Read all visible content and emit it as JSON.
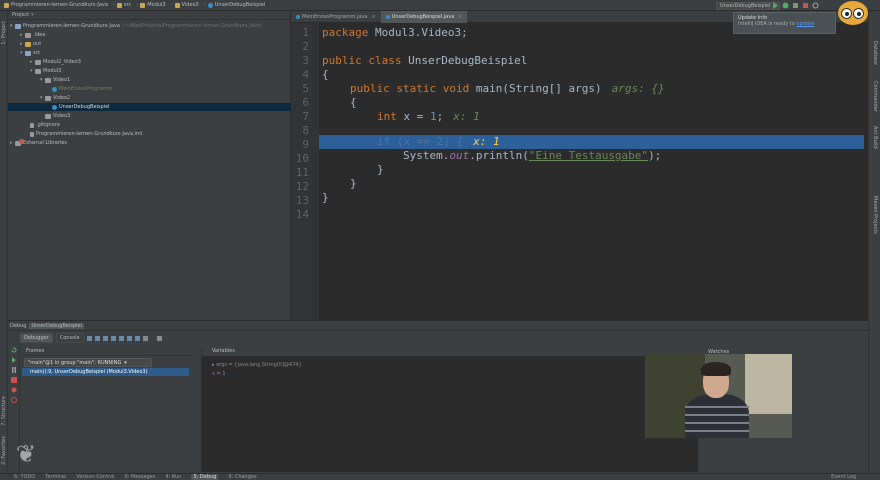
{
  "navbar": {
    "crumbs": [
      "Programmieren-lernen-Grundkurs-Java",
      "src",
      "Modul3",
      "Video3",
      "UnserDebugBeispiel"
    ],
    "run_config": "UnserDebugBeispiel"
  },
  "project": {
    "title": "Project",
    "tree": [
      {
        "label": "Programmieren-lernen-Grundkurs-Java",
        "path": "(~/WebProjects/Programmieren-lernen-Grundkurs-Java)"
      },
      {
        "label": ".idea"
      },
      {
        "label": "out"
      },
      {
        "label": "src"
      },
      {
        "label": "Modul2_Video3"
      },
      {
        "label": "Modul3"
      },
      {
        "label": "Video1"
      },
      {
        "label": "MeinErstesProgramm"
      },
      {
        "label": "Video2"
      },
      {
        "label": "UnserDebugBeispiel"
      },
      {
        "label": "Video3"
      },
      {
        "label": ".gitignore"
      },
      {
        "label": "Programmieren-lernen-Grundkurs-Java.iml"
      },
      {
        "label": "External Libraries"
      }
    ]
  },
  "tabs": [
    {
      "label": "MeinErstesProgramm.java"
    },
    {
      "label": "UnserDebugBeispiel.java"
    }
  ],
  "editor": {
    "line_numbers": [
      "1",
      "2",
      "3",
      "4",
      "5",
      "6",
      "7",
      "8",
      "9",
      "10",
      "11",
      "12",
      "13",
      "14"
    ],
    "l1_kw": "package",
    "l1_rest": " Modul3.Video3;",
    "l3_kw": "public class",
    "l3_rest": " UnserDebugBeispiel",
    "l4": "{",
    "l5_kw": "public static void",
    "l5_rest": " main(String[] args)",
    "l5_hint": "args: {}",
    "l6": "{",
    "l7_kw": "int",
    "l7_a": " x = ",
    "l7_num": "1",
    "l7_b": ";",
    "l7_hint": "x: 1",
    "l9_code": "if (x == 2) {",
    "l9_hint": "x: 1",
    "l10_a": "System.",
    "l10_out": "out",
    "l10_b": ".println(",
    "l10_str": "\"Eine Testausgabe\"",
    "l10_c": ");",
    "l11": "}",
    "l12": "}",
    "l13": "}"
  },
  "notification": {
    "title": "Update Info",
    "body": "IntelliJ IDEA is ready to ",
    "link": "update"
  },
  "debug": {
    "title": "Debug",
    "config": "UnserDebugBeispiel",
    "tab_debugger": "Debugger",
    "tab_console": "Console",
    "frames_label": "Frames",
    "thread": "\"main\"@1 in group \"main\": RUNNING",
    "frame": "main():9, UnserDebugBeispiel (Modul3.Video3)",
    "variables_label": "Variables",
    "var_name": "args",
    "var_value": "= {java.lang.String[0]@474}",
    "var2_name": "x",
    "var2_value": "= 1",
    "watches_label": "Watches"
  },
  "status": {
    "tabs": [
      "6: TODO",
      "Terminal",
      "Version Control",
      "0: Messages",
      "4: Run",
      "5: Debug",
      "9: Changes",
      "Event Log"
    ]
  },
  "side": {
    "project": "1: Project",
    "structure": "7: Structure",
    "favorites": "2: Favorites",
    "maven": "Maven Projects",
    "commander": "Commander",
    "ant": "Ant Build",
    "database": "Database"
  },
  "colors": {
    "accent": "#2d6099",
    "breakpoint": "#c75450",
    "selection": "#0d293e"
  }
}
